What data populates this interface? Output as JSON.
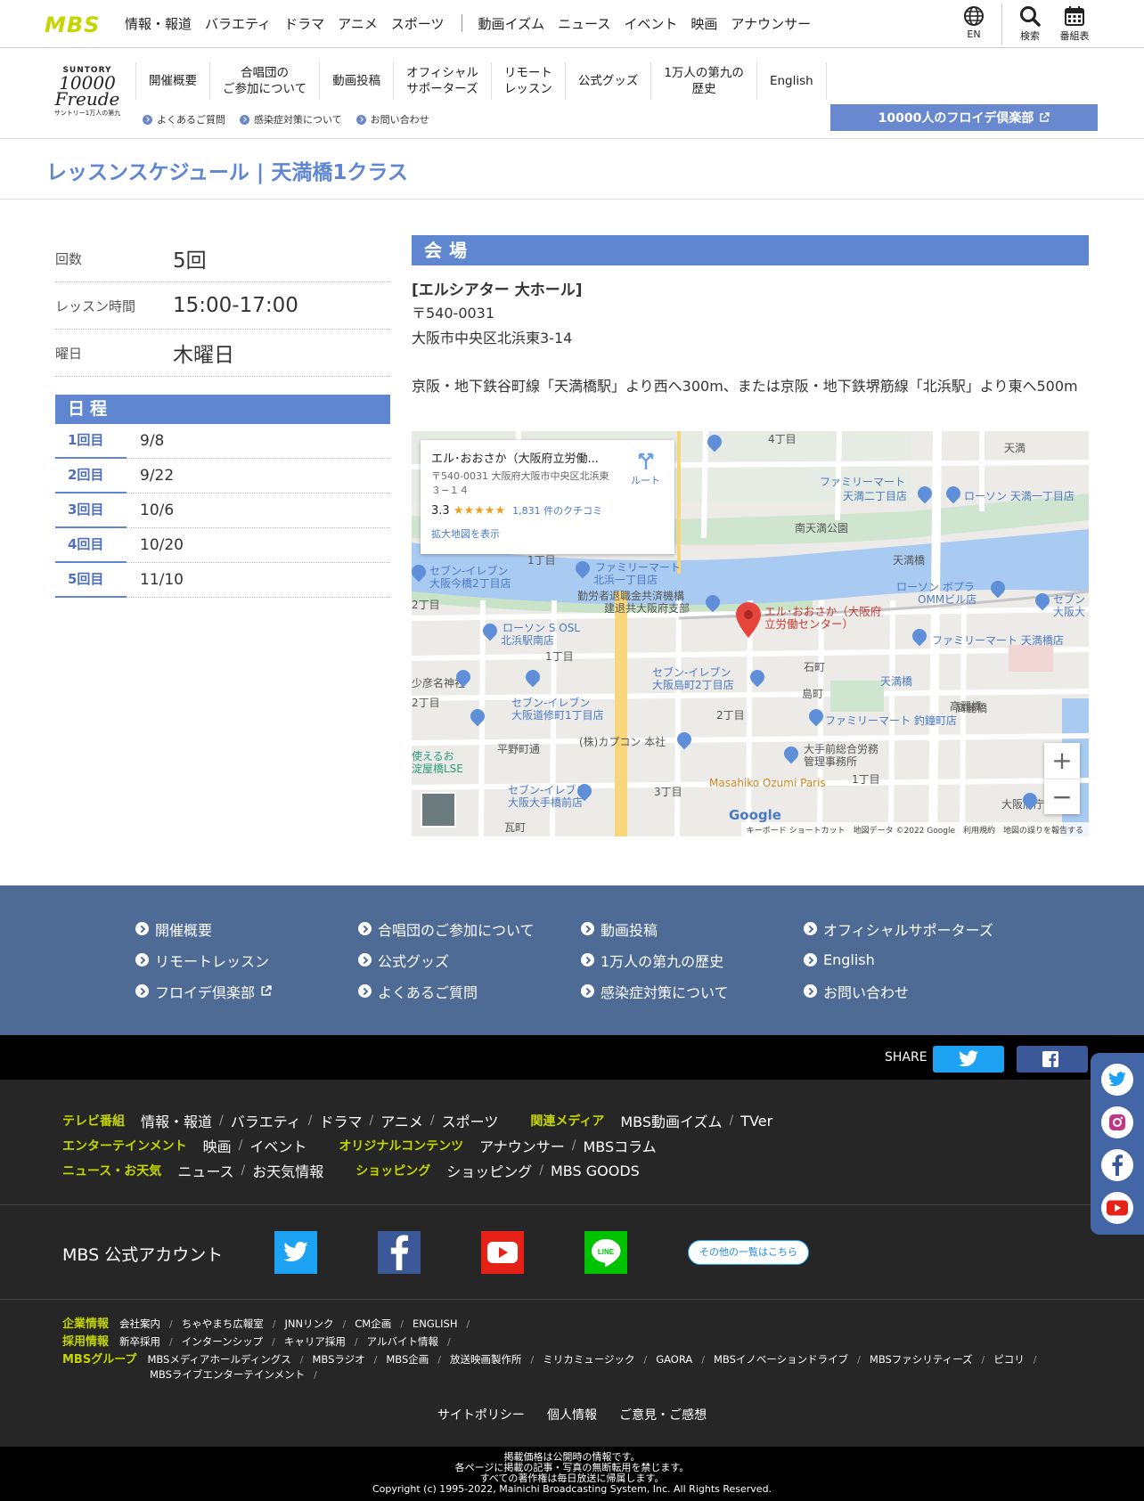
{
  "global_header": {
    "logo": "MBS",
    "nav": [
      "情報・報道",
      "バラエティ",
      "ドラマ",
      "アニメ",
      "スポーツ"
    ],
    "nav2": [
      "動画イズム",
      "ニュース",
      "イベント",
      "映画",
      "アナウンサー"
    ],
    "lang_label": "EN",
    "search_label": "検索",
    "schedule_label": "番組表"
  },
  "sub_header": {
    "logo_top": "SUNTORY",
    "logo_mid": "10000 Freude",
    "logo_bottom": "サントリー1万人の第九",
    "menu": [
      {
        "line1": "開催概要",
        "line2": ""
      },
      {
        "line1": "合唱団の",
        "line2": "ご参加について"
      },
      {
        "line1": "動画投稿",
        "line2": ""
      },
      {
        "line1": "オフィシャル",
        "line2": "サポーターズ"
      },
      {
        "line1": "リモート",
        "line2": "レッスン"
      },
      {
        "line1": "公式グッズ",
        "line2": ""
      },
      {
        "line1": "1万人の第九の",
        "line2": "歴史"
      },
      {
        "line1": "English",
        "line2": ""
      }
    ],
    "sublinks": [
      "よくあるご質問",
      "感染症対策について",
      "お問い合わせ"
    ],
    "club_button": "10000人のフロイデ倶楽部"
  },
  "page_title": "レッスンスケジュール | 天満橋1クラス",
  "info": {
    "rows": [
      {
        "key": "回数",
        "value": "5回"
      },
      {
        "key": "レッスン時間",
        "value": "15:00-17:00"
      },
      {
        "key": "曜日",
        "value": "木曜日"
      }
    ]
  },
  "schedule": {
    "heading": "日程",
    "rows": [
      {
        "num": "1回目",
        "date": "9/8"
      },
      {
        "num": "2回目",
        "date": "9/22"
      },
      {
        "num": "3回目",
        "date": "10/6"
      },
      {
        "num": "4回目",
        "date": "10/20"
      },
      {
        "num": "5回目",
        "date": "11/10"
      }
    ]
  },
  "venue": {
    "heading": "会場",
    "name": "[エルシアター 大ホール]",
    "postal": "〒540-0031",
    "address": "大阪市中央区北浜東3-14",
    "access": "京阪・地下鉄谷町線「天満橋駅」より西へ300m、または京阪・地下鉄堺筋線「北浜駅」より東へ500m"
  },
  "map": {
    "card_title": "エル･おおさか（大阪府立労働...",
    "card_address": "〒540-0031 大阪府大阪市中央区北浜東３−１４",
    "rating": "3.3",
    "stars": "★★★★★",
    "reviews": "1,831 件のクチコミ",
    "enlarge": "拡大地図を表示",
    "route": "ルート",
    "pin_label": "エル･おおさか（大阪府立労働センター）",
    "labels": [
      "4丁目",
      "天満",
      "ファミリーマート",
      "天満二丁目店",
      "ローソン 天満一丁目店",
      "南天満公園",
      "天満橋",
      "1丁目",
      "ファミリーマート",
      "北浜一丁目店",
      "セブン-イレブン",
      "大阪今橋2丁目店",
      "勤労者退職金共済機構",
      "建退共大阪府支部",
      "ローソン ボプラ",
      "OMMビル店",
      "ファミリーマート 天満橋店",
      "ローソン S OSL",
      "北浜駅南店",
      "1丁目",
      "石町",
      "島町",
      "天満橋",
      "高麗橋",
      "セブン-イレブン",
      "大阪島町2丁目店",
      "セブン-イレブン",
      "大阪道修町1丁目店",
      "2丁目",
      "ファミリーマート 釣鐘町店",
      "平野町通",
      "(株)カプコン 本社",
      "大手前総合労務",
      "管理事務所",
      "Masahiko Ozumi Paris",
      "3丁目",
      "1丁目",
      "セブン-イレブン",
      "大阪大手橋前店",
      "瓦町",
      "大阪府庁",
      "2丁目",
      "2丁目",
      "少彦名神社",
      "高麗橋",
      "セブン",
      "大阪大",
      "使えるお",
      "淀屋橋LSE"
    ],
    "attribution": "キーボード ショートカット　地図データ ©2022 Google　利用規約　地図の誤りを報告する",
    "google": "Google"
  },
  "footer_links": [
    "開催概要",
    "合唱団のご参加について",
    "動画投稿",
    "オフィシャルサポーターズ",
    "リモートレッスン",
    "公式グッズ",
    "1万人の第九の歴史",
    "English",
    "フロイデ倶楽部",
    "よくあるご質問",
    "感染症対策について",
    "お問い合わせ"
  ],
  "share": {
    "label": "SHARE"
  },
  "dark_footer": {
    "row1": {
      "cat1": "テレビ番組",
      "l1": [
        "情報・報道",
        "バラエティ",
        "ドラマ",
        "アニメ",
        "スポーツ"
      ],
      "cat2": "関連メディア",
      "l2": [
        "MBS動画イズム",
        "TVer"
      ]
    },
    "row2": {
      "cat1": "エンターテインメント",
      "l1": [
        "映画",
        "イベント"
      ],
      "cat2": "オリジナルコンテンツ",
      "l2": [
        "アナウンサー",
        "MBSコラム"
      ]
    },
    "row3": {
      "cat1": "ニュース・お天気",
      "l1": [
        "ニュース",
        "お天気情報"
      ],
      "cat2": "ショッピング",
      "l2": [
        "ショッピング",
        "MBS GOODS"
      ]
    },
    "accounts_title": "MBS 公式アカウント",
    "more_button": "その他の一覧はこちら",
    "corp": {
      "cat": "企業情報",
      "links": [
        "会社案内",
        "ちゃやまち広報室",
        "JNNリンク",
        "CM企画",
        "ENGLISH"
      ]
    },
    "recruit": {
      "cat": "採用情報",
      "links": [
        "新卒採用",
        "インターンシップ",
        "キャリア採用",
        "アルバイト情報"
      ]
    },
    "group": {
      "cat": "MBSグループ",
      "links": [
        "MBSメディアホールディングス",
        "MBSラジオ",
        "MBS企画",
        "放送映画製作所",
        "ミリカミュージック",
        "GAORA",
        "MBSイノベーションドライブ",
        "MBSファシリティーズ",
        "ピコリ",
        "MBSライブエンターテインメント"
      ]
    },
    "policy": [
      "サイトポリシー",
      "個人情報",
      "ご意見・ご感想"
    ]
  },
  "copyright": [
    "掲載価格は公開時の情報です。",
    "各ページに掲載の記事・写真の無断転用を禁じます。",
    "すべての著作権は毎日放送に帰属します。",
    "Copyright (c) 1995-2022, Mainichi Broadcasting System, Inc. All Rights Reserved."
  ],
  "colors": {
    "accent": "#5f86d0",
    "lime": "#c4d500",
    "footer_blue": "#4d6b95",
    "dark": "#262626"
  },
  "icons": [
    "globe-icon",
    "search-icon",
    "calendar-icon",
    "external-link-icon",
    "twitter-icon",
    "facebook-icon",
    "youtube-icon",
    "line-icon",
    "instagram-icon",
    "map-pin-icon",
    "route-icon",
    "zoom-in-icon",
    "zoom-out-icon"
  ]
}
